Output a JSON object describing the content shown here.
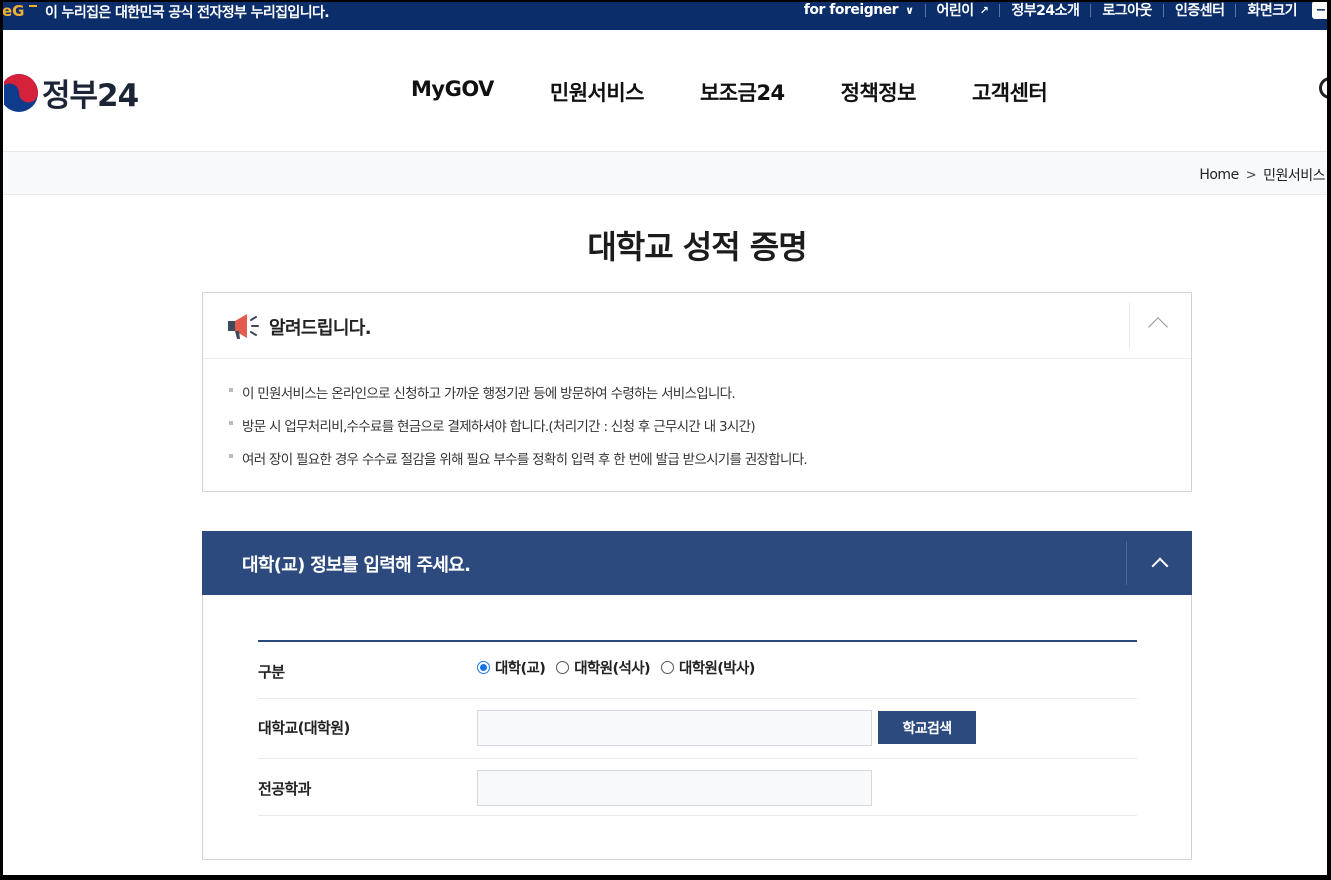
{
  "gov_banner": {
    "message": "이 누리집은 대한민국 공식 전자정부 누리집입니다.",
    "links": [
      "for foreigner",
      "어린이",
      "정부24소개",
      "로그아웃",
      "인증센터",
      "화면크기"
    ]
  },
  "header": {
    "brand": "정부24",
    "nav": [
      "MyGOV",
      "민원서비스",
      "보조금24",
      "정책정보",
      "고객센터"
    ]
  },
  "breadcrumb": [
    "Home",
    "민원서비스"
  ],
  "page_title": "대학교 성적 증명",
  "notice": {
    "heading": "알려드립니다.",
    "items": [
      "이 민원서비스는 온라인으로 신청하고 가까운 행정기관 등에 방문하여 수령하는 서비스입니다.",
      "방문 시 업무처리비,수수료를 현금으로 결제하셔야 합니다.(처리기간 : 신청 후 근무시간 내 3시간)",
      "여러 장이 필요한 경우 수수료 절감을 위해 필요 부수를 정확히 입력 후 한 번에 발급 받으시기를 권장합니다."
    ]
  },
  "form": {
    "heading": "대학(교) 정보를 입력해 주세요.",
    "rows": {
      "type_label": "구분",
      "options": [
        "대학(교)",
        "대학원(석사)",
        "대학원(박사)"
      ],
      "selected_option": "대학(교)",
      "university_label": "대학교(대학원)",
      "university_value": "",
      "search_button": "학교검색",
      "major_label": "전공학과",
      "major_value": ""
    }
  },
  "colors": {
    "gov_bar": "#0b2e6b",
    "panel_header": "#2c4a7e",
    "radio_selected": "#1a73e8"
  }
}
